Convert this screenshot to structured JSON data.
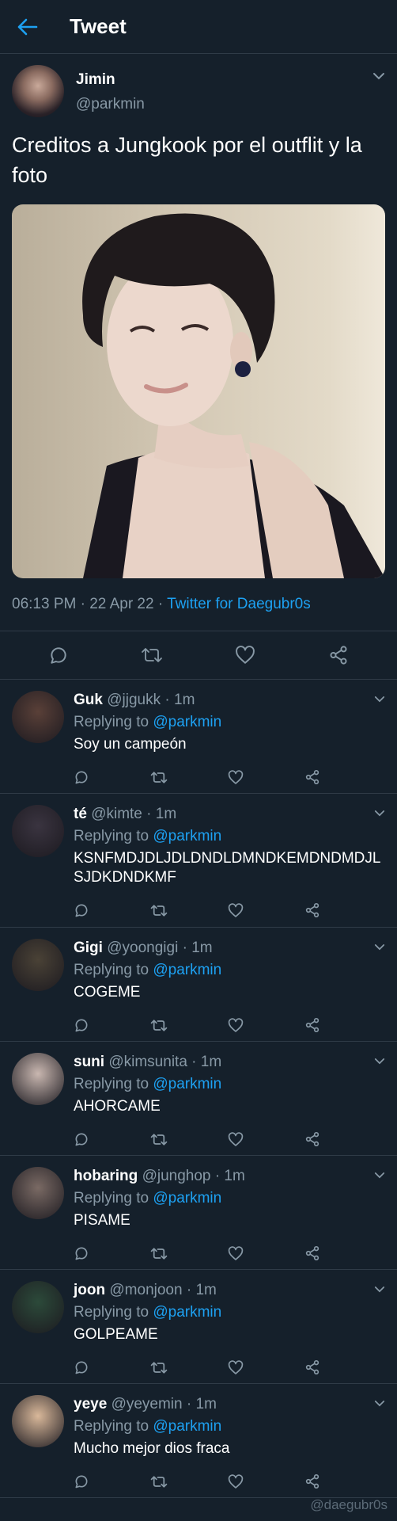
{
  "header": {
    "title": "Tweet"
  },
  "tweet": {
    "author_name": "Jimin",
    "author_handle": "@parkmin",
    "text": "Creditos a Jungkook por el outflit y la foto",
    "time": "06:13 PM",
    "date": "22 Apr 22",
    "client": "Twitter for Daegubr0s"
  },
  "replies": [
    {
      "name": "Guk",
      "handle": "@jjgukk",
      "time": "1m",
      "replying_label": "Replying to",
      "mention": "@parkmin",
      "text": "Soy un campeón",
      "avatar_color": "#5a4038"
    },
    {
      "name": "té",
      "handle": "@kimte",
      "time": "1m",
      "replying_label": "Replying to",
      "mention": "@parkmin",
      "text": "KSNFMDJDLJDLDNDLDMNDKEMDNDMDJLSJDKDNDKMF",
      "avatar_color": "#3a3440"
    },
    {
      "name": "Gigi",
      "handle": "@yoongigi",
      "time": "1m",
      "replying_label": "Replying to",
      "mention": "@parkmin",
      "text": "COGEME",
      "avatar_color": "#4a4236"
    },
    {
      "name": "suni",
      "handle": "@kimsunita",
      "time": "1m",
      "replying_label": "Replying to",
      "mention": "@parkmin",
      "text": "AHORCAME",
      "avatar_color": "#c9b7b0"
    },
    {
      "name": "hobaring",
      "handle": "@junghop",
      "time": "1m",
      "replying_label": "Replying to",
      "mention": "@parkmin",
      "text": "PISAME",
      "avatar_color": "#7a6a64"
    },
    {
      "name": "joon",
      "handle": "@monjoon",
      "time": "1m",
      "replying_label": "Replying to",
      "mention": "@parkmin",
      "text": "GOLPEAME",
      "avatar_color": "#2c4a3a"
    },
    {
      "name": "yeye",
      "handle": "@yeyemin",
      "time": "1m",
      "replying_label": "Replying to",
      "mention": "@parkmin",
      "text": "Mucho mejor dios fraca",
      "avatar_color": "#d9b89a"
    }
  ],
  "watermark": "@daegubr0s",
  "colors": {
    "background": "#15202b",
    "accent": "#1da1f2",
    "muted": "#8899a6",
    "divider": "#2f3b47"
  }
}
